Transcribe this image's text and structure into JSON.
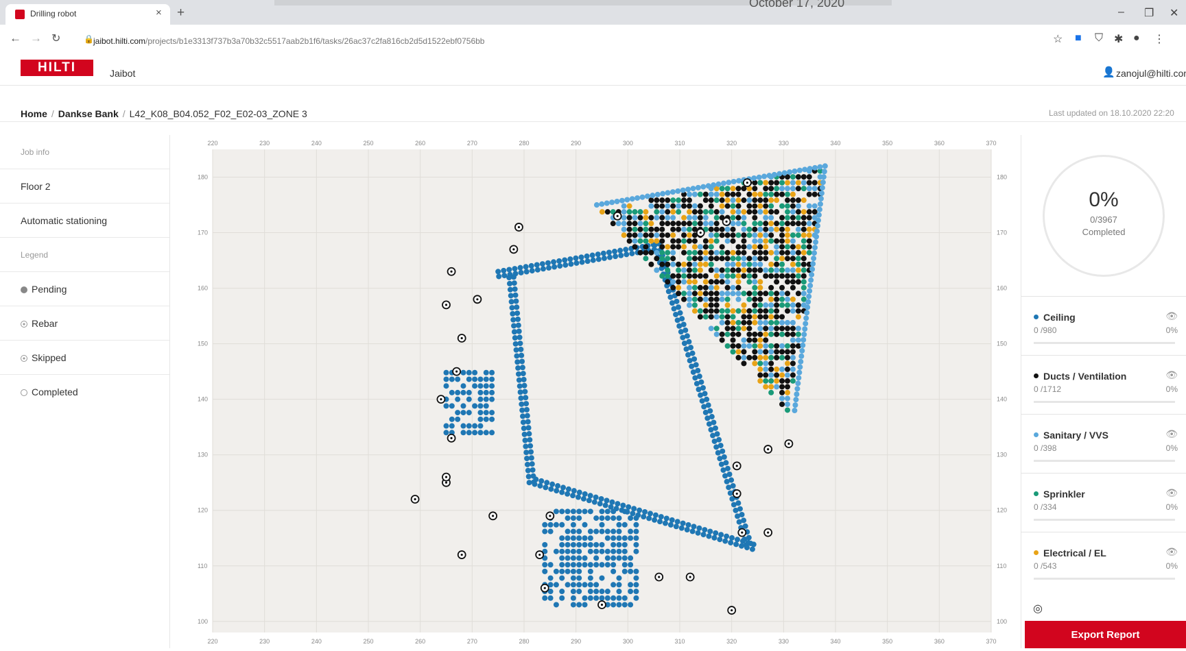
{
  "window": {
    "caption_date": "October 17, 2020"
  },
  "tab": {
    "title": "Drilling robot",
    "close": "×",
    "new": "+"
  },
  "window_controls": {
    "minimize": "–",
    "restore": "❐",
    "close": "✕"
  },
  "address": {
    "host": "jaibot.hilti.com",
    "path": "/projects/b1e3313f737b3a70b32c5517aab2b1f6/tasks/26ac37c2fa816cb2d5d1522ebf0756bb"
  },
  "app": {
    "logo": "HILTI",
    "name": "Jaibot",
    "user": "zanojul@hilti.com"
  },
  "breadcrumb": {
    "home": "Home",
    "project": "Dankse Bank",
    "task": "L42_K08_B04.052_F02_E02-03_ZONE 3"
  },
  "last_updated": "Last updated on 18.10.2020 22:20",
  "sidebar": {
    "job_info": "Job info",
    "floor": "Floor 2",
    "stationing": "Automatic stationing",
    "legend": "Legend",
    "legend_items": [
      {
        "label": "Pending",
        "icon": "filled-circle-icon"
      },
      {
        "label": "Rebar",
        "icon": "circled-dot-icon"
      },
      {
        "label": "Skipped",
        "icon": "circled-dot-icon"
      },
      {
        "label": "Completed",
        "icon": "hollow-circle-icon"
      }
    ]
  },
  "progress": {
    "percent": "0%",
    "count": "0/3967",
    "status": "Completed"
  },
  "categories": [
    {
      "name": "Ceiling",
      "count": "0 /980",
      "pct": "0%",
      "color": "#1f77b4"
    },
    {
      "name": "Ducts / Ventilation",
      "count": "0 /1712",
      "pct": "0%",
      "color": "#111111"
    },
    {
      "name": "Sanitary / VVS",
      "count": "0 /398",
      "pct": "0%",
      "color": "#5aa8dc"
    },
    {
      "name": "Sprinkler",
      "count": "0 /334",
      "pct": "0%",
      "color": "#1a9a78"
    },
    {
      "name": "Electrical / EL",
      "count": "0 /543",
      "pct": "0%",
      "color": "#e8a317"
    }
  ],
  "export_label": "Export Report",
  "chart_data": {
    "type": "scatter",
    "xlim": [
      220,
      370
    ],
    "ylim": [
      98,
      185
    ],
    "x_ticks": [
      220,
      230,
      240,
      250,
      260,
      270,
      280,
      290,
      300,
      310,
      320,
      330,
      340,
      350,
      360,
      370
    ],
    "y_ticks": [
      100,
      110,
      120,
      130,
      140,
      150,
      160,
      170,
      180
    ],
    "grid": true,
    "series": [
      {
        "name": "Ceiling",
        "color": "#1f77b4",
        "shape": "loop",
        "points": [
          [
            275,
            163
          ],
          [
            306,
            168
          ],
          [
            324,
            113
          ],
          [
            281,
            125
          ],
          [
            277,
            163
          ]
        ]
      },
      {
        "name": "Ducts / Ventilation",
        "color": "#111111",
        "region": [
          [
            294,
            174
          ],
          [
            337,
            181
          ],
          [
            332,
            137
          ],
          [
            327,
            138
          ]
        ]
      },
      {
        "name": "Electrical / EL",
        "color": "#e8a317",
        "region": [
          [
            294,
            175
          ],
          [
            338,
            182
          ],
          [
            333,
            137
          ]
        ]
      },
      {
        "name": "Sprinkler",
        "color": "#1a9a78",
        "region": [
          [
            300,
            176
          ],
          [
            336,
            181
          ],
          [
            330,
            140
          ]
        ]
      },
      {
        "name": "Sanitary / VVS",
        "color": "#5aa8dc",
        "region": [
          [
            294,
            175
          ],
          [
            338,
            182
          ],
          [
            332,
            137
          ]
        ]
      }
    ],
    "rebar_markers": [
      [
        279,
        171
      ],
      [
        278,
        167
      ],
      [
        266,
        163
      ],
      [
        265,
        157
      ],
      [
        271,
        158
      ],
      [
        268,
        151
      ],
      [
        267,
        145
      ],
      [
        264,
        140
      ],
      [
        266,
        133
      ],
      [
        265,
        125
      ],
      [
        265,
        126
      ],
      [
        259,
        122
      ],
      [
        274,
        119
      ],
      [
        268,
        112
      ],
      [
        283,
        112
      ],
      [
        284,
        106
      ],
      [
        285,
        119
      ],
      [
        295,
        103
      ],
      [
        306,
        108
      ],
      [
        312,
        108
      ],
      [
        320,
        102
      ],
      [
        322,
        116
      ],
      [
        327,
        116
      ],
      [
        321,
        123
      ],
      [
        321,
        128
      ],
      [
        327,
        131
      ],
      [
        331,
        132
      ],
      [
        314,
        170
      ],
      [
        323,
        179
      ],
      [
        298,
        173
      ],
      [
        319,
        172
      ]
    ]
  }
}
